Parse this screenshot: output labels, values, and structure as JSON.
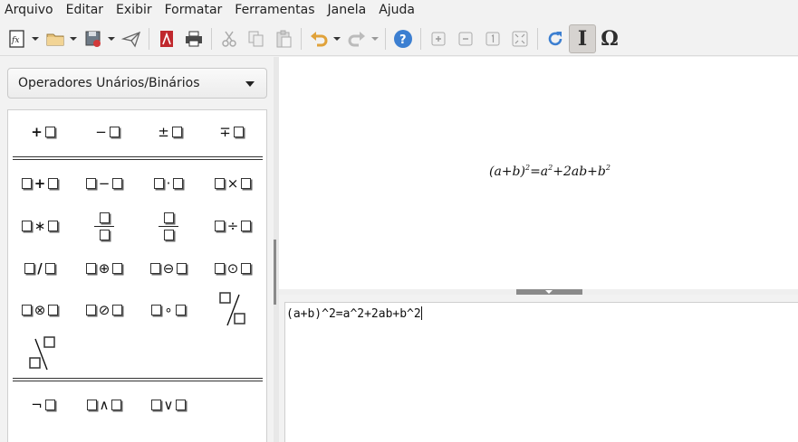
{
  "menu": [
    "Arquivo",
    "Editar",
    "Exibir",
    "Formatar",
    "Ferramentas",
    "Janela",
    "Ajuda"
  ],
  "elements_panel": {
    "category": "Operadores Unários/Binários",
    "unary": [
      "+",
      "−",
      "±",
      "∓"
    ],
    "binary_row1": [
      "+",
      "−",
      "·",
      "×"
    ],
    "binary_row2_ops": [
      "∗",
      "÷"
    ],
    "binary_row3": [
      "/",
      "⊕",
      "⊖",
      "⊙"
    ],
    "binary_row4": [
      "⊗",
      "⊘",
      "∘"
    ],
    "logic": [
      "¬",
      "∧",
      "∨"
    ]
  },
  "preview": {
    "open": "(a+b)",
    "exp1": "2",
    "mid": "=a",
    "exp2": "2",
    "mid2": "+2ab+b",
    "exp3": "2"
  },
  "editor": {
    "command": "(a+b)^2=a^2+2ab+b^2"
  },
  "colors": {
    "accent_blue": "#3c7fd1",
    "accent_red": "#c0282d",
    "active_tool_bg": "#d6d3d0"
  }
}
